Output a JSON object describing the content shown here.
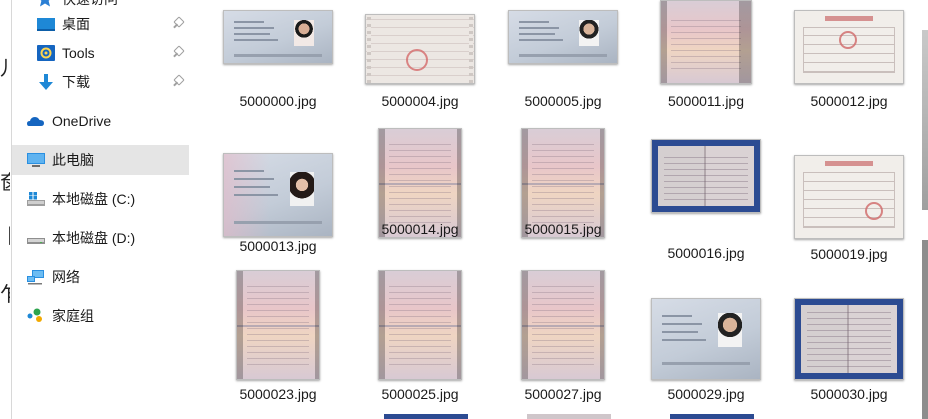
{
  "navigation": {
    "quick_access_partial": "快速访问",
    "items": [
      {
        "label": "桌面",
        "icon": "desktop-icon",
        "pinned": true
      },
      {
        "label": "Tools",
        "icon": "tools-folder-icon",
        "pinned": true
      },
      {
        "label": "下载",
        "icon": "download-arrow-icon",
        "pinned": true
      },
      {
        "label": "OneDrive",
        "icon": "onedrive-cloud-icon",
        "pinned": false
      },
      {
        "label": "此电脑",
        "icon": "computer-icon",
        "pinned": false,
        "selected": true
      },
      {
        "label": "本地磁盘 (C:)",
        "icon": "windows-drive-icon",
        "pinned": false
      },
      {
        "label": "本地磁盘 (D:)",
        "icon": "drive-icon",
        "pinned": false
      },
      {
        "label": "网络",
        "icon": "network-icon",
        "pinned": false
      },
      {
        "label": "家庭组",
        "icon": "homegroup-icon",
        "pinned": false
      }
    ]
  },
  "files": [
    {
      "name": "5000000.jpg",
      "kind": "id-card"
    },
    {
      "name": "5000004.jpg",
      "kind": "form-doc"
    },
    {
      "name": "5000005.jpg",
      "kind": "id-card"
    },
    {
      "name": "5000011.jpg",
      "kind": "passport-pink"
    },
    {
      "name": "5000012.jpg",
      "kind": "cert-doc"
    },
    {
      "name": "5000013.jpg",
      "kind": "id-card-female"
    },
    {
      "name": "5000014.jpg",
      "kind": "passport-pink"
    },
    {
      "name": "5000015.jpg",
      "kind": "passport-pink"
    },
    {
      "name": "5000016.jpg",
      "kind": "blue-book"
    },
    {
      "name": "5000019.jpg",
      "kind": "cert-doc"
    },
    {
      "name": "5000023.jpg",
      "kind": "passport-pink"
    },
    {
      "name": "5000025.jpg",
      "kind": "passport-pink"
    },
    {
      "name": "5000027.jpg",
      "kind": "passport-pink"
    },
    {
      "name": "5000029.jpg",
      "kind": "id-card"
    },
    {
      "name": "5000030.jpg",
      "kind": "blue-book"
    }
  ],
  "colors": {
    "selected_nav_bg": "#e5e5e5",
    "desktop_icon": "#1e88d6",
    "onedrive_icon": "#1565c0",
    "homegroup_icon": "#2da44e"
  }
}
